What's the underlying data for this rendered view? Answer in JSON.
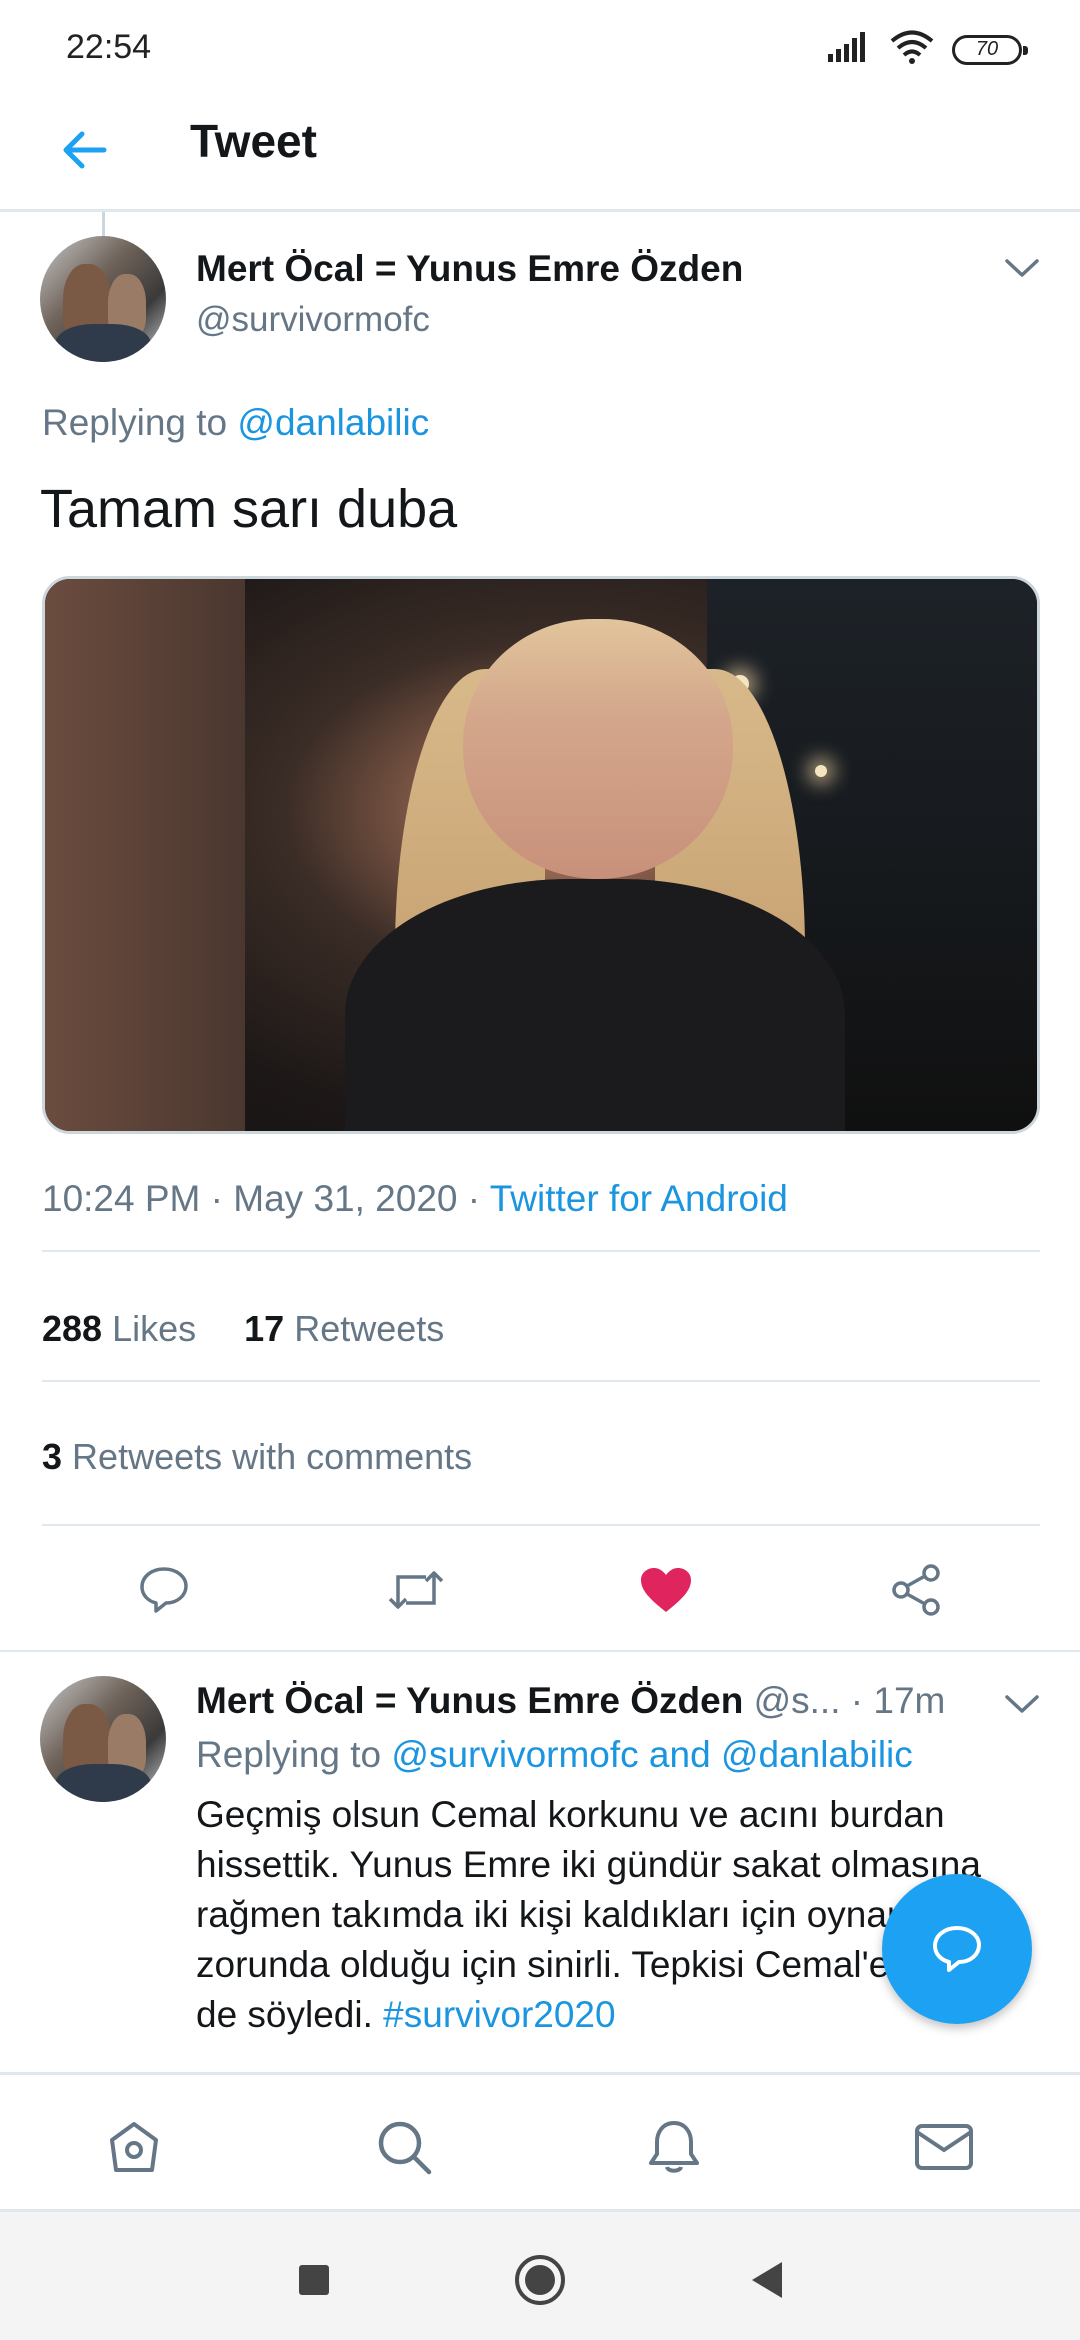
{
  "status_bar": {
    "time": "22:54",
    "battery": "70"
  },
  "header": {
    "title": "Tweet"
  },
  "tweet": {
    "name": "Mert Öcal = Yunus Emre Özden",
    "handle": "@survivormofc",
    "replying_prefix": "Replying to",
    "replying_to": "@danlabilic",
    "text": "Tamam sarı duba",
    "time": "10:24 PM",
    "date": "May 31, 2020",
    "source": "Twitter for Android",
    "likes_count": "288",
    "likes_label": "Likes",
    "retweets_count": "17",
    "retweets_label": "Retweets",
    "rwc_count": "3",
    "rwc_label": "Retweets with comments",
    "liked": true
  },
  "reply": {
    "name": "Mert Öcal = Yunus Emre Özden",
    "handle": "@s...",
    "time": "· 17m",
    "replying_prefix": "Replying to",
    "replying_to": "@survivormofc and @danlabilic",
    "text": "Geçmiş olsun Cemal korkunu ve acını burdan hissettik. Yunus Emre iki gündür sakat olmasına rağmen takımda iki kişi kaldıkları için oynamak zorunda olduğu için sinirli. Tepkisi Cemal'e kendi de söyledi.",
    "hashtag": "#survivor2020"
  },
  "colors": {
    "accent": "#1da1f2",
    "link": "#1b95e0",
    "like": "#e0245e",
    "secondary_text": "#657786"
  }
}
